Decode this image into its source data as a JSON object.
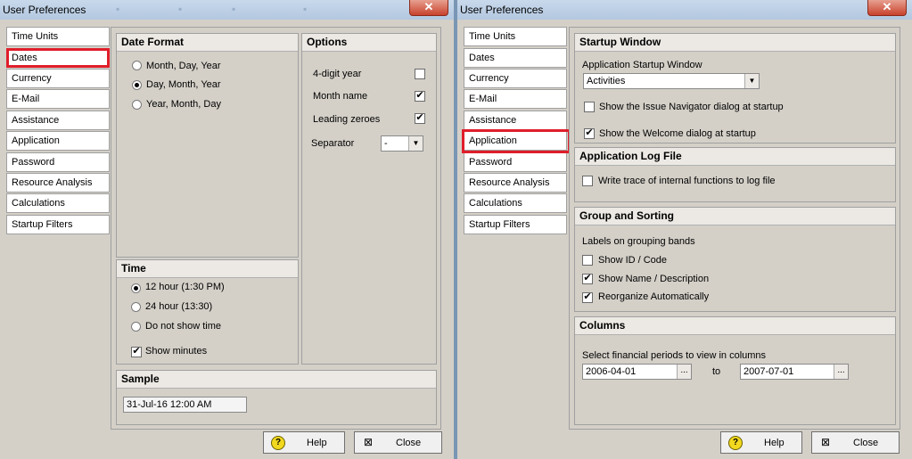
{
  "window_title": "User Preferences",
  "close_glyph": "✕",
  "tabs": [
    "Time Units",
    "Dates",
    "Currency",
    "E-Mail",
    "Assistance",
    "Application",
    "Password",
    "Resource Analysis",
    "Calculations",
    "Startup Filters"
  ],
  "left": {
    "selected_tab": "Dates",
    "date_format": {
      "title": "Date Format",
      "options": [
        "Month, Day, Year",
        "Day, Month, Year",
        "Year, Month, Day"
      ],
      "selected": "Day, Month, Year"
    },
    "options": {
      "title": "Options",
      "four_digit_year": {
        "label": "4-digit year",
        "checked": false
      },
      "month_name": {
        "label": "Month name",
        "checked": true
      },
      "leading_zeroes": {
        "label": "Leading zeroes",
        "checked": true
      },
      "separator_label": "Separator",
      "separator_value": "-"
    },
    "time": {
      "title": "Time",
      "options": [
        "12 hour (1:30 PM)",
        "24 hour (13:30)",
        "Do not show time"
      ],
      "selected": "12 hour (1:30 PM)",
      "show_minutes": {
        "label": "Show minutes",
        "checked": true
      }
    },
    "sample": {
      "title": "Sample",
      "value": "31-Jul-16 12:00 AM"
    }
  },
  "right": {
    "selected_tab": "Application",
    "startup": {
      "title": "Startup Window",
      "field_label": "Application Startup Window",
      "field_value": "Activities",
      "issue_nav": {
        "label": "Show the Issue Navigator dialog at startup",
        "checked": false
      },
      "welcome": {
        "label": "Show the Welcome dialog at startup",
        "checked": true
      }
    },
    "logfile": {
      "title": "Application Log File",
      "write_trace": {
        "label": "Write trace of internal functions to log file",
        "checked": false
      }
    },
    "grouping": {
      "title": "Group and Sorting",
      "subtitle": "Labels on grouping bands",
      "show_id": {
        "label": "Show ID / Code",
        "checked": false
      },
      "show_name": {
        "label": "Show Name / Description",
        "checked": true
      },
      "reorganize": {
        "label": "Reorganize Automatically",
        "checked": true
      }
    },
    "columns": {
      "title": "Columns",
      "subtitle": "Select financial periods to view in columns",
      "from": "2006-04-01",
      "to_label": "to",
      "to": "2007-07-01"
    }
  },
  "buttons": {
    "help": "Help",
    "close": "Close",
    "ellipsis": "..."
  },
  "colors": {
    "highlight": "#e01e2a",
    "title_bar": "#c9d9ec",
    "panel": "#d4d0c8"
  }
}
